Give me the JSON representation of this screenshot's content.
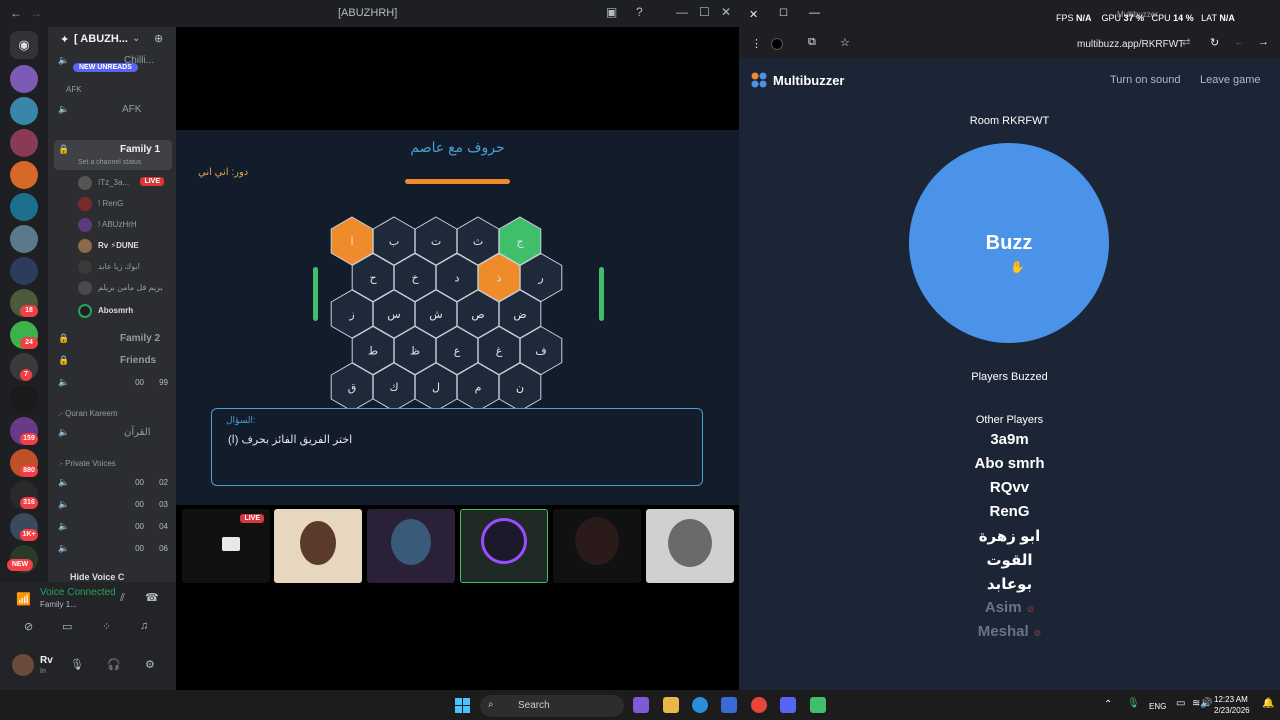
{
  "discord": {
    "window_title": "[ABUZHRH]",
    "server_name": "[ ABUZH...",
    "new_unreads": "NEW UNREADS",
    "top_channel": "Chilli...",
    "category_afk": "AFK",
    "channels": {
      "afk": "AFK",
      "family1": "Family 1",
      "family1_status": "Set a channel status",
      "family2": "Family 2",
      "friends": "Friends",
      "quran": "القرآن",
      "private1": "00",
      "private2": "00",
      "private3": "00",
      "private4": "00"
    },
    "counts": {
      "friends_b": "00",
      "friends_c": "99",
      "p1": "02",
      "p2": "03",
      "p3": "04",
      "p4": "06"
    },
    "categories": {
      "quran": ".- Quran Kareem",
      "private": ".- Private Voices",
      "hide": "Hide Voice C"
    },
    "members": [
      "ITz_3a...",
      "! RenG",
      "! ABUzHrH",
      "Rv ⚡DUNE",
      "ابوك زيا عابد",
      "بريم فل مامن بريلم",
      "Abosmrh"
    ],
    "live": "LIVE",
    "voice_status": "Voice Connected",
    "voice_channel": "Family 1...",
    "user_name": "Rv",
    "user_status": "In",
    "guild_badges": [
      "18",
      "24",
      "7",
      "159",
      "880",
      "316",
      "1K+",
      "NEW"
    ]
  },
  "game": {
    "title": "حروف مع عاصم",
    "turn": "دور: اني اني",
    "question_label": "السؤال:",
    "question_text": "اختر الفريق الفائز بحرف (ا)",
    "rows": [
      [
        "ا",
        "ب",
        "ت",
        "ث",
        "ج"
      ],
      [
        "ح",
        "خ",
        "د",
        "ذ",
        "ر"
      ],
      [
        "ز",
        "س",
        "ش",
        "ص",
        "ض"
      ],
      [
        "ط",
        "ظ",
        "ع",
        "غ",
        "ف"
      ],
      [
        "ق",
        "ك",
        "ل",
        "م",
        "ن"
      ]
    ],
    "orange_cells": [
      "0-0",
      "1-3"
    ],
    "green_cells": [
      "0-4"
    ],
    "colors": {
      "orange": "#f08b2c",
      "green": "#3fbf6a",
      "neutral": "#1e2a3a"
    }
  },
  "stage": {
    "live": "LIVE"
  },
  "browser": {
    "tab_title": "Multibuzzer",
    "url": "multibuzz.app/RKRFWT",
    "hud": {
      "fps": "FPS",
      "fps_val": "N/A",
      "gpu": "GPU",
      "gpu_val": "37 %",
      "cpu": "CPU",
      "cpu_val": "14 %",
      "lat": "LAT",
      "lat_val": "N/A"
    }
  },
  "multibuzzer": {
    "brand": "Multibuzzer",
    "turn_on_sound": "Turn on sound",
    "leave_game": "Leave game",
    "room": "Room RKRFWT",
    "buzz": "Buzz",
    "players_buzzed": "Players Buzzed",
    "other_players": "Other Players",
    "players": [
      "3a9m",
      "Abo smrh",
      "RQvv",
      "RenG",
      "ابو زهرة",
      "القوت",
      "بوعابد"
    ],
    "offline_players": [
      "Asim",
      "Meshal"
    ],
    "brand_color": "#4b93e8"
  },
  "taskbar": {
    "search": "Search",
    "lang": "ENG",
    "time": "12:23 AM",
    "date": "2/23/2026"
  }
}
